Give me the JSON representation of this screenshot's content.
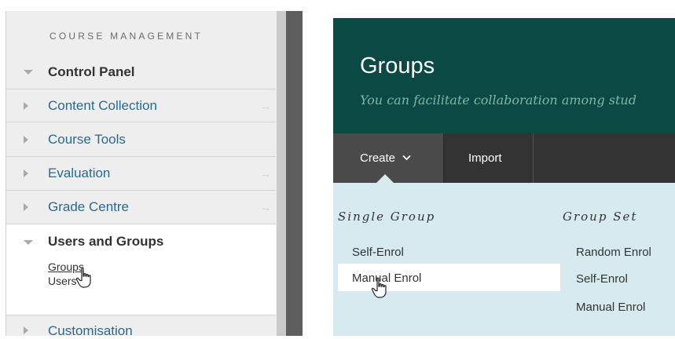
{
  "course_management": {
    "title": "COURSE MANAGEMENT",
    "control_panel": "Control Panel",
    "items": [
      {
        "label": "Content Collection",
        "arrow": "→"
      },
      {
        "label": "Course Tools",
        "arrow": ""
      },
      {
        "label": "Evaluation",
        "arrow": "→"
      },
      {
        "label": "Grade Centre",
        "arrow": "→"
      }
    ],
    "users_and_groups": {
      "label": "Users and Groups",
      "sub_items": [
        "Groups",
        "Users"
      ]
    },
    "customisation": "Customisation"
  },
  "groups_page": {
    "title": "Groups",
    "subtitle": "You can facilitate collaboration among stud",
    "toolbar": {
      "create_label": "Create",
      "import_label": "Import"
    },
    "menu": {
      "single_group_heading": "Single Group",
      "single_group_items": [
        "Self-Enrol",
        "Manual Enrol"
      ],
      "group_set_heading": "Group Set",
      "group_set_items": [
        "Random Enrol",
        "Self-Enrol",
        "Manual Enrol"
      ],
      "highlighted_item": "Manual Enrol"
    }
  },
  "colors": {
    "header_bg": "#0b4a44",
    "toolbar_bg": "#333333",
    "menu_bg": "#d7eaf0",
    "link_blue": "#2a6a8e"
  },
  "icons": {
    "cursor": "hand-pointer-icon",
    "expand": "triangle-right-icon",
    "collapse": "triangle-down-icon",
    "create_dropdown": "chevron-down-icon"
  }
}
